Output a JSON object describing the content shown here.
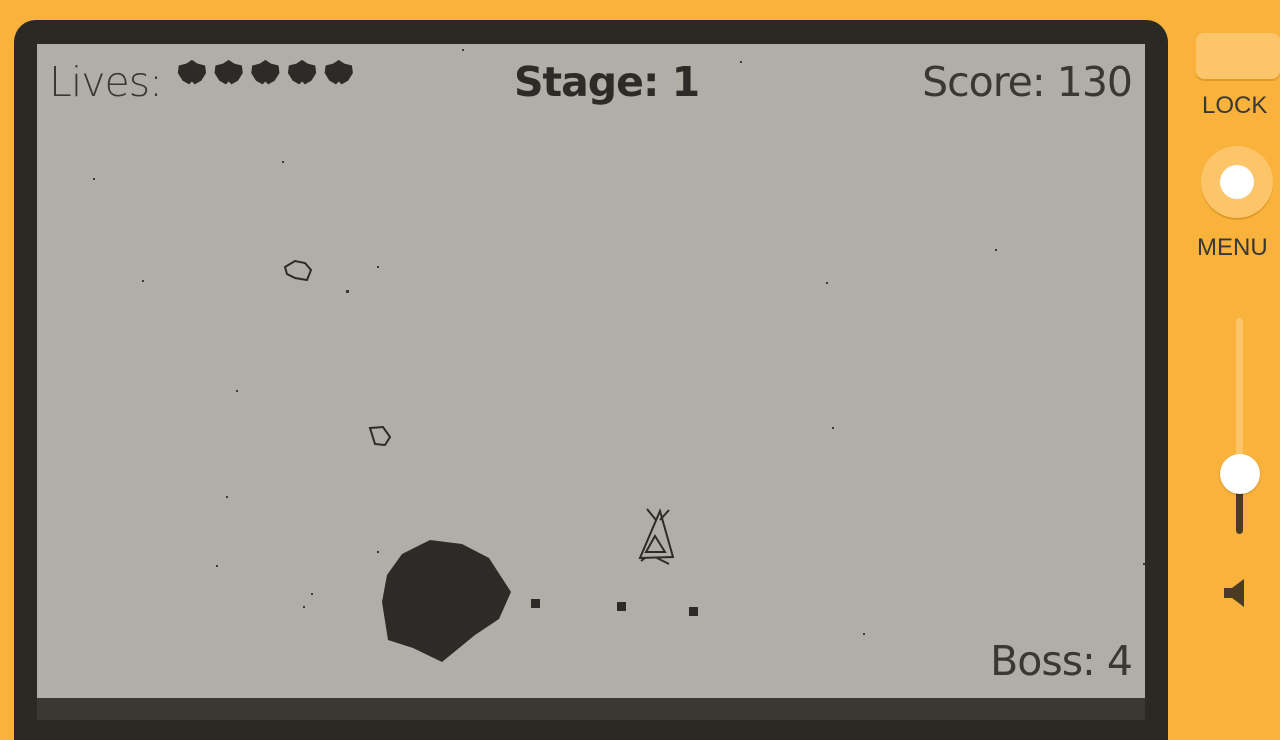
{
  "hud": {
    "lives_label": "Lives:",
    "lives_count": 5,
    "stage_label": "Stage: 1",
    "score_label": "Score: 130",
    "boss_label": "Boss: 4"
  },
  "controls": {
    "lock_label": "LOCK",
    "menu_label": "MENU",
    "volume_level": 0.28
  },
  "colors": {
    "device": "#F9B33C",
    "screen": "#B0AEA7",
    "ink": "#2D2B27"
  }
}
